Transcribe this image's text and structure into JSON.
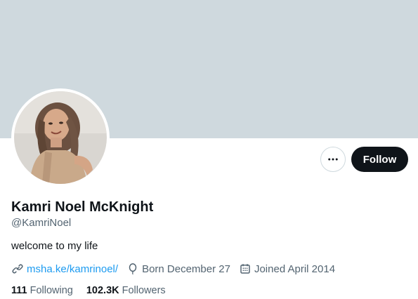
{
  "profile": {
    "display_name": "Kamri Noel McKnight",
    "handle": "@KamriNoel",
    "bio": "welcome to my life",
    "website": "msha.ke/kamrinoel/",
    "birthday": "Born December 27",
    "joined": "Joined April 2014"
  },
  "actions": {
    "follow_label": "Follow",
    "more_icon": "more-horizontal-icon"
  },
  "stats": {
    "following_count": "111",
    "following_label": "Following",
    "followers_count": "102.3K",
    "followers_label": "Followers"
  },
  "colors": {
    "banner": "#cfd9de",
    "link": "#1d9bf0",
    "primary_text": "#0f1419",
    "secondary_text": "#536471",
    "follow_button": "#0f1419"
  }
}
